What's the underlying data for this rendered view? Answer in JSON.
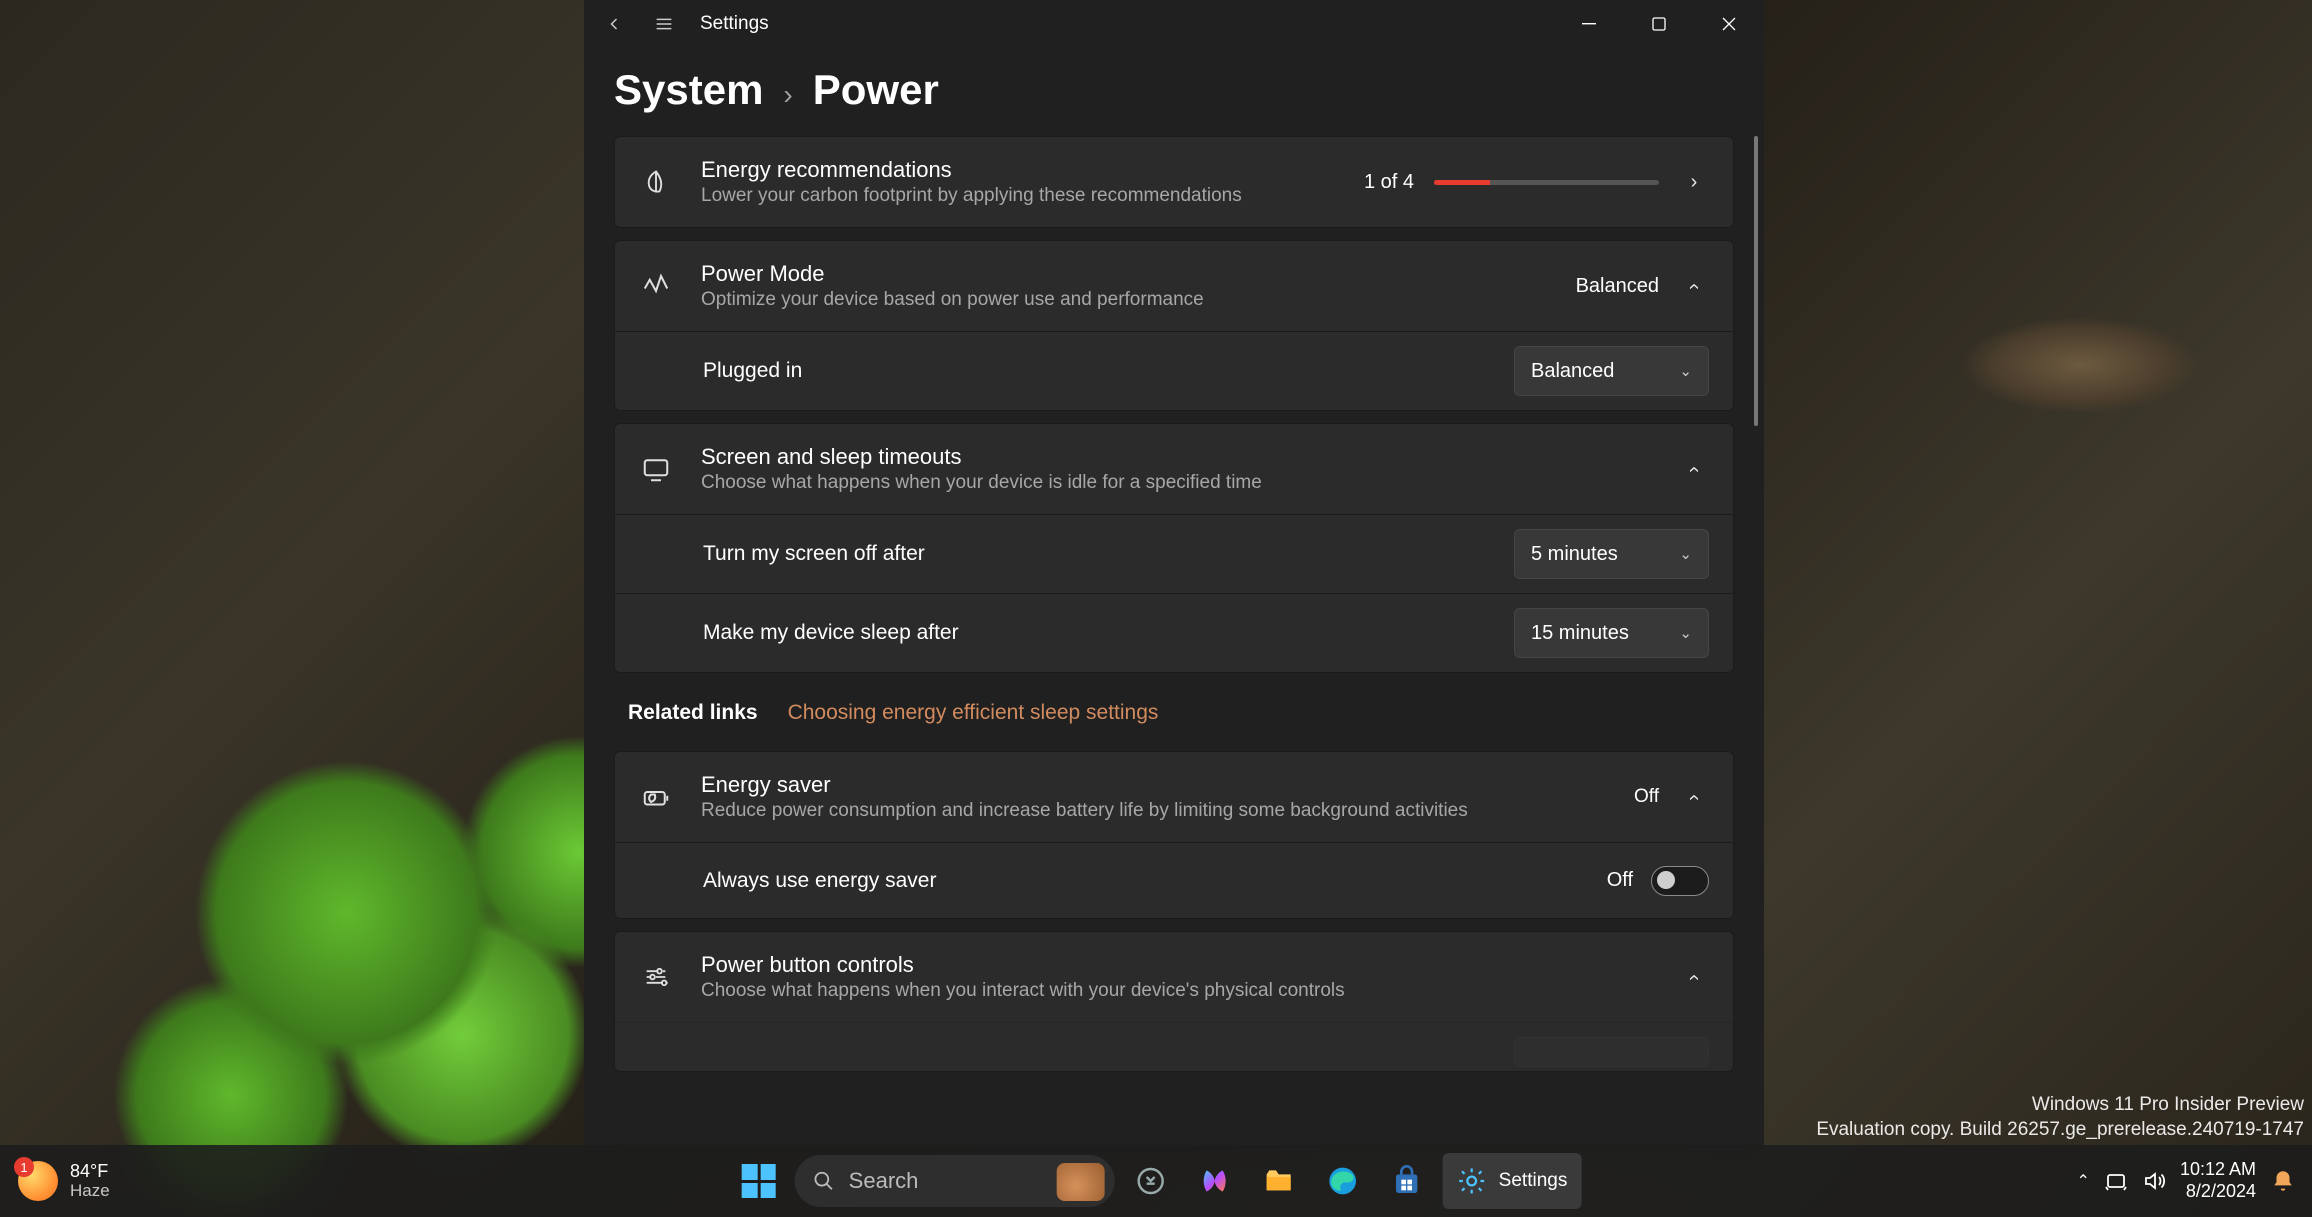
{
  "window": {
    "app_title": "Settings",
    "breadcrumb_parent": "System",
    "breadcrumb_current": "Power"
  },
  "energy_rec": {
    "title": "Energy recommendations",
    "subtitle": "Lower your carbon footprint by applying these recommendations",
    "progress_text": "1 of 4",
    "progress_percent": 25
  },
  "power_mode": {
    "title": "Power Mode",
    "subtitle": "Optimize your device based on power use and performance",
    "value": "Balanced",
    "plugged_in_label": "Plugged in",
    "plugged_in_value": "Balanced"
  },
  "screen_sleep": {
    "title": "Screen and sleep timeouts",
    "subtitle": "Choose what happens when your device is idle for a specified time",
    "screen_off_label": "Turn my screen off after",
    "screen_off_value": "5 minutes",
    "sleep_label": "Make my device sleep after",
    "sleep_value": "15 minutes"
  },
  "related": {
    "label": "Related links",
    "link_text": "Choosing energy efficient sleep settings"
  },
  "energy_saver": {
    "title": "Energy saver",
    "subtitle": "Reduce power consumption and increase battery life by limiting some background activities",
    "status": "Off",
    "always_label": "Always use energy saver",
    "always_value": "Off"
  },
  "power_button": {
    "title": "Power button controls",
    "subtitle": "Choose what happens when you interact with your device's physical controls"
  },
  "watermark": {
    "line1": "Windows 11 Pro Insider Preview",
    "line2": "Evaluation copy. Build 26257.ge_prerelease.240719-1747"
  },
  "taskbar": {
    "weather_badge": "1",
    "weather_temp": "84°F",
    "weather_cond": "Haze",
    "search_placeholder": "Search",
    "settings_label": "Settings",
    "time": "10:12 AM",
    "date": "8/2/2024"
  }
}
